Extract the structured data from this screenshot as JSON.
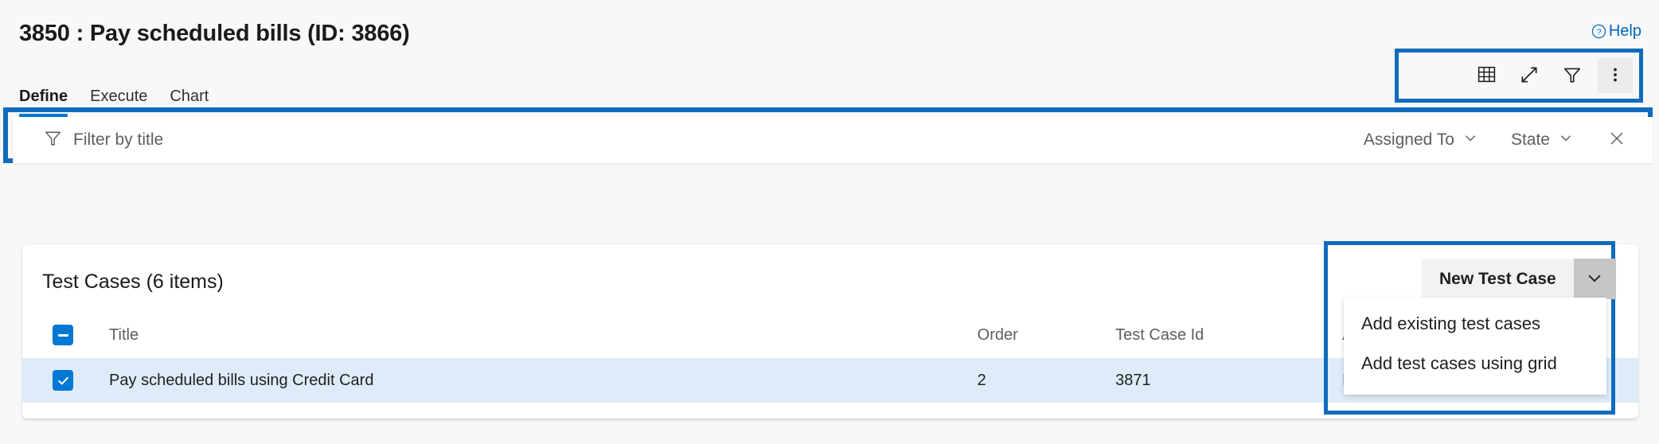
{
  "header": {
    "work_item_title": "3850 : Pay scheduled bills (ID: 3866)",
    "help_label": "Help"
  },
  "tabs": [
    {
      "label": "Define",
      "active": true
    },
    {
      "label": "Execute",
      "active": false
    },
    {
      "label": "Chart",
      "active": false
    }
  ],
  "toolbar": {
    "buttons": [
      {
        "name": "grid-view-icon",
        "tooltip": "Column options"
      },
      {
        "name": "expand-icon",
        "tooltip": "Enter full screen"
      },
      {
        "name": "filter-icon",
        "tooltip": "Filter"
      },
      {
        "name": "more-options-icon",
        "tooltip": "More options"
      }
    ]
  },
  "filter_bar": {
    "placeholder": "Filter by title",
    "value": "",
    "assigned_to_label": "Assigned To",
    "state_label": "State",
    "clear_label": "Close"
  },
  "test_cases": {
    "heading": "Test Cases (6 items)",
    "columns": [
      "Title",
      "Order",
      "Test Case Id",
      "Assigned"
    ],
    "rows": [
      {
        "selected": true,
        "title": "Pay scheduled bills using Credit Card",
        "order": "2",
        "test_case_id": "3871",
        "assigned_to": "Franc"
      }
    ]
  },
  "new_test_case": {
    "button_label": "New Test Case",
    "menu_items": [
      "Add existing test cases",
      "Add test cases using grid"
    ]
  },
  "colors": {
    "accent_blue": "#0078d4",
    "highlight_box": "#0f6cbd",
    "link_blue": "#0066bf",
    "selected_row": "#deecf9",
    "page_background": "#f8f8f8"
  }
}
